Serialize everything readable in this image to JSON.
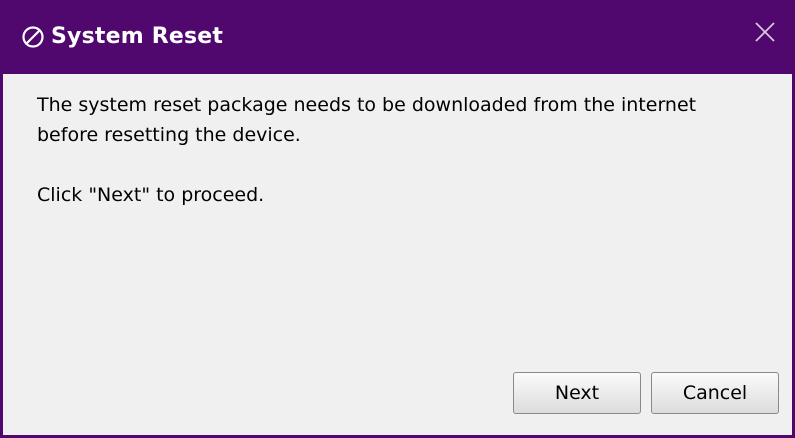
{
  "dialog": {
    "title": "System Reset",
    "title_icon": "circle-slash-icon",
    "close_icon": "close-icon"
  },
  "message": {
    "line1": "The system reset package needs to be downloaded from the internet",
    "line2": "before resetting the device.",
    "line3": "Click \"Next\" to proceed."
  },
  "buttons": {
    "next_label": "Next",
    "cancel_label": "Cancel"
  },
  "colors": {
    "titlebar": "#50076e",
    "content_background": "#f0f0f0",
    "title_text": "#ffffff"
  }
}
